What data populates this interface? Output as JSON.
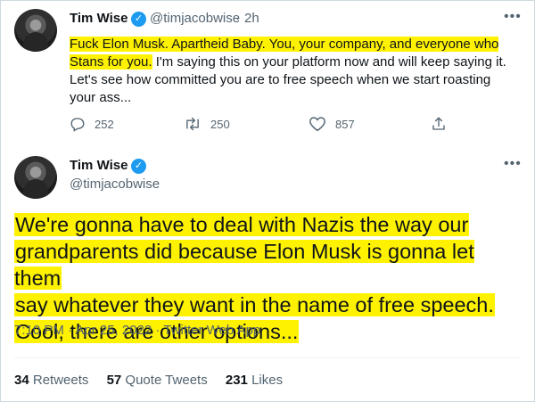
{
  "reply_tweet": {
    "display_name": "Tim Wise",
    "handle": "@timjacobwise",
    "separator": "·",
    "time_ago": "2h",
    "highlighted_text": "Fuck Elon Musk. Apartheid Baby. You, your company, and everyone who Stans for you.",
    "text": " I'm saying this on your platform now and will keep saying it. Let's see how committed you are to free speech when we start roasting your ass...",
    "replies": "252",
    "retweets": "250",
    "likes": "857"
  },
  "main_tweet": {
    "display_name": "Tim Wise",
    "handle": "@timjacobwise",
    "text_lines": [
      "We're gonna have to deal with Nazis the way our",
      "grandparents did because Elon Musk is gonna let them",
      "say whatever they want in the name of free speech.",
      "Cool, there are other options..."
    ],
    "timestamp": "7:10 PM · Apr 25, 2022 · Twitter Web App",
    "retweets_count": "34",
    "retweets_label": "Retweets",
    "quote_count": "57",
    "quote_label": "Quote Tweets",
    "likes_count": "231",
    "likes_label": "Likes"
  },
  "icons": {
    "verified": "verified-badge-icon",
    "more": "more-options-icon",
    "reply": "reply-icon",
    "retweet": "retweet-icon",
    "like": "heart-icon",
    "share": "share-icon"
  },
  "colors": {
    "highlight": "#fff200",
    "verified": "#1d9bf0",
    "muted": "#536471"
  }
}
